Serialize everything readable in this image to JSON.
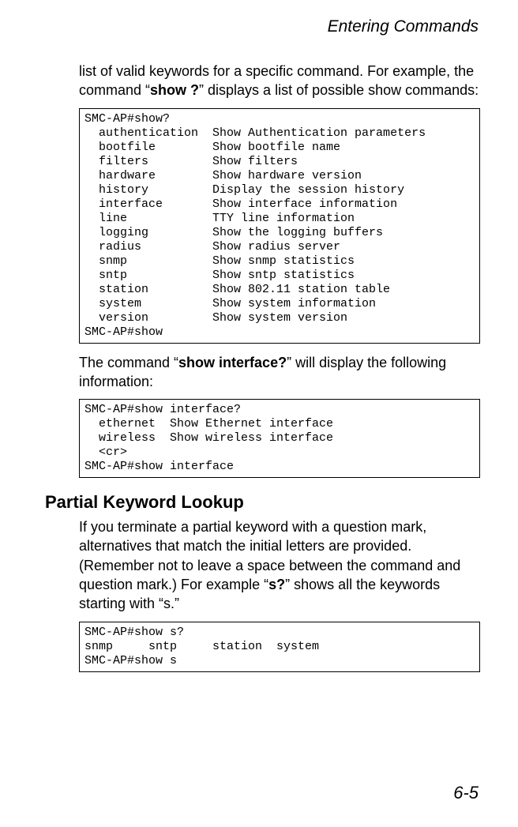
{
  "header": "Entering Commands",
  "para1": {
    "pre": "list of valid keywords for a specific command. For example, the command “",
    "bold": "show ?",
    "post": "” displays a list of possible show commands:"
  },
  "code1": "SMC-AP#show?\n  authentication  Show Authentication parameters\n  bootfile        Show bootfile name\n  filters         Show filters\n  hardware        Show hardware version\n  history         Display the session history\n  interface       Show interface information\n  line            TTY line information\n  logging         Show the logging buffers\n  radius          Show radius server\n  snmp            Show snmp statistics\n  sntp            Show sntp statistics\n  station         Show 802.11 station table\n  system          Show system information\n  version         Show system version\nSMC-AP#show",
  "para2": {
    "pre": "The command “",
    "bold": "show interface?",
    "post": "” will display the following information:"
  },
  "code2": "SMC-AP#show interface?\n  ethernet  Show Ethernet interface\n  wireless  Show wireless interface\n  <cr>\nSMC-AP#show interface",
  "section_heading": "Partial Keyword Lookup",
  "para3": {
    "pre": "If you terminate a partial keyword with a question mark, alternatives that match the initial letters are provided. (Remember not to leave a space between the command and question mark.) For example “",
    "bold": "s?",
    "post": "” shows all the keywords starting with “s.”"
  },
  "code3": "SMC-AP#show s?\nsnmp     sntp     station  system\nSMC-AP#show s",
  "page_number": "6-5"
}
